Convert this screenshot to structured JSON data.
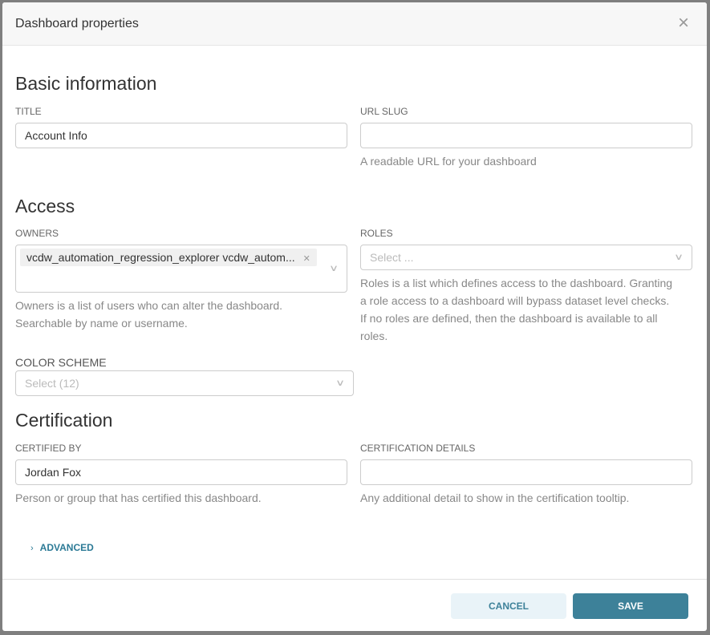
{
  "modal": {
    "title": "Dashboard properties",
    "close_icon": "×"
  },
  "basic": {
    "heading": "Basic information",
    "title_label": "TITLE",
    "title_value": "Account Info",
    "slug_label": "URL SLUG",
    "slug_value": "",
    "slug_help": "A readable URL for your dashboard"
  },
  "access": {
    "heading": "Access",
    "owners_label": "OWNERS",
    "owner_tag": "vcdw_automation_regression_explorer vcdw_autom...",
    "owners_help_1": "Owners is a list of users who can alter the dashboard.",
    "owners_help_2": "Searchable by name or username.",
    "roles_label": "ROLES",
    "roles_placeholder": "Select ...",
    "roles_help": [
      "Roles is a list which defines access to the dashboard. Granting",
      "a role access to a dashboard will bypass dataset level checks.",
      "If no roles are defined, then the dashboard is available to all",
      "roles."
    ],
    "color_label": "COLOR SCHEME",
    "color_placeholder": "Select (12)"
  },
  "certification": {
    "heading": "Certification",
    "by_label": "CERTIFIED BY",
    "by_value": "Jordan Fox",
    "by_help": "Person or group that has certified this dashboard.",
    "details_label": "CERTIFICATION DETAILS",
    "details_value": "",
    "details_help": "Any additional detail to show in the certification tooltip."
  },
  "advanced": {
    "label": "ADVANCED"
  },
  "footer": {
    "cancel": "CANCEL",
    "save": "SAVE"
  },
  "colors": {
    "accent": "#3d8199",
    "cancel_bg": "#e9f3f8"
  }
}
